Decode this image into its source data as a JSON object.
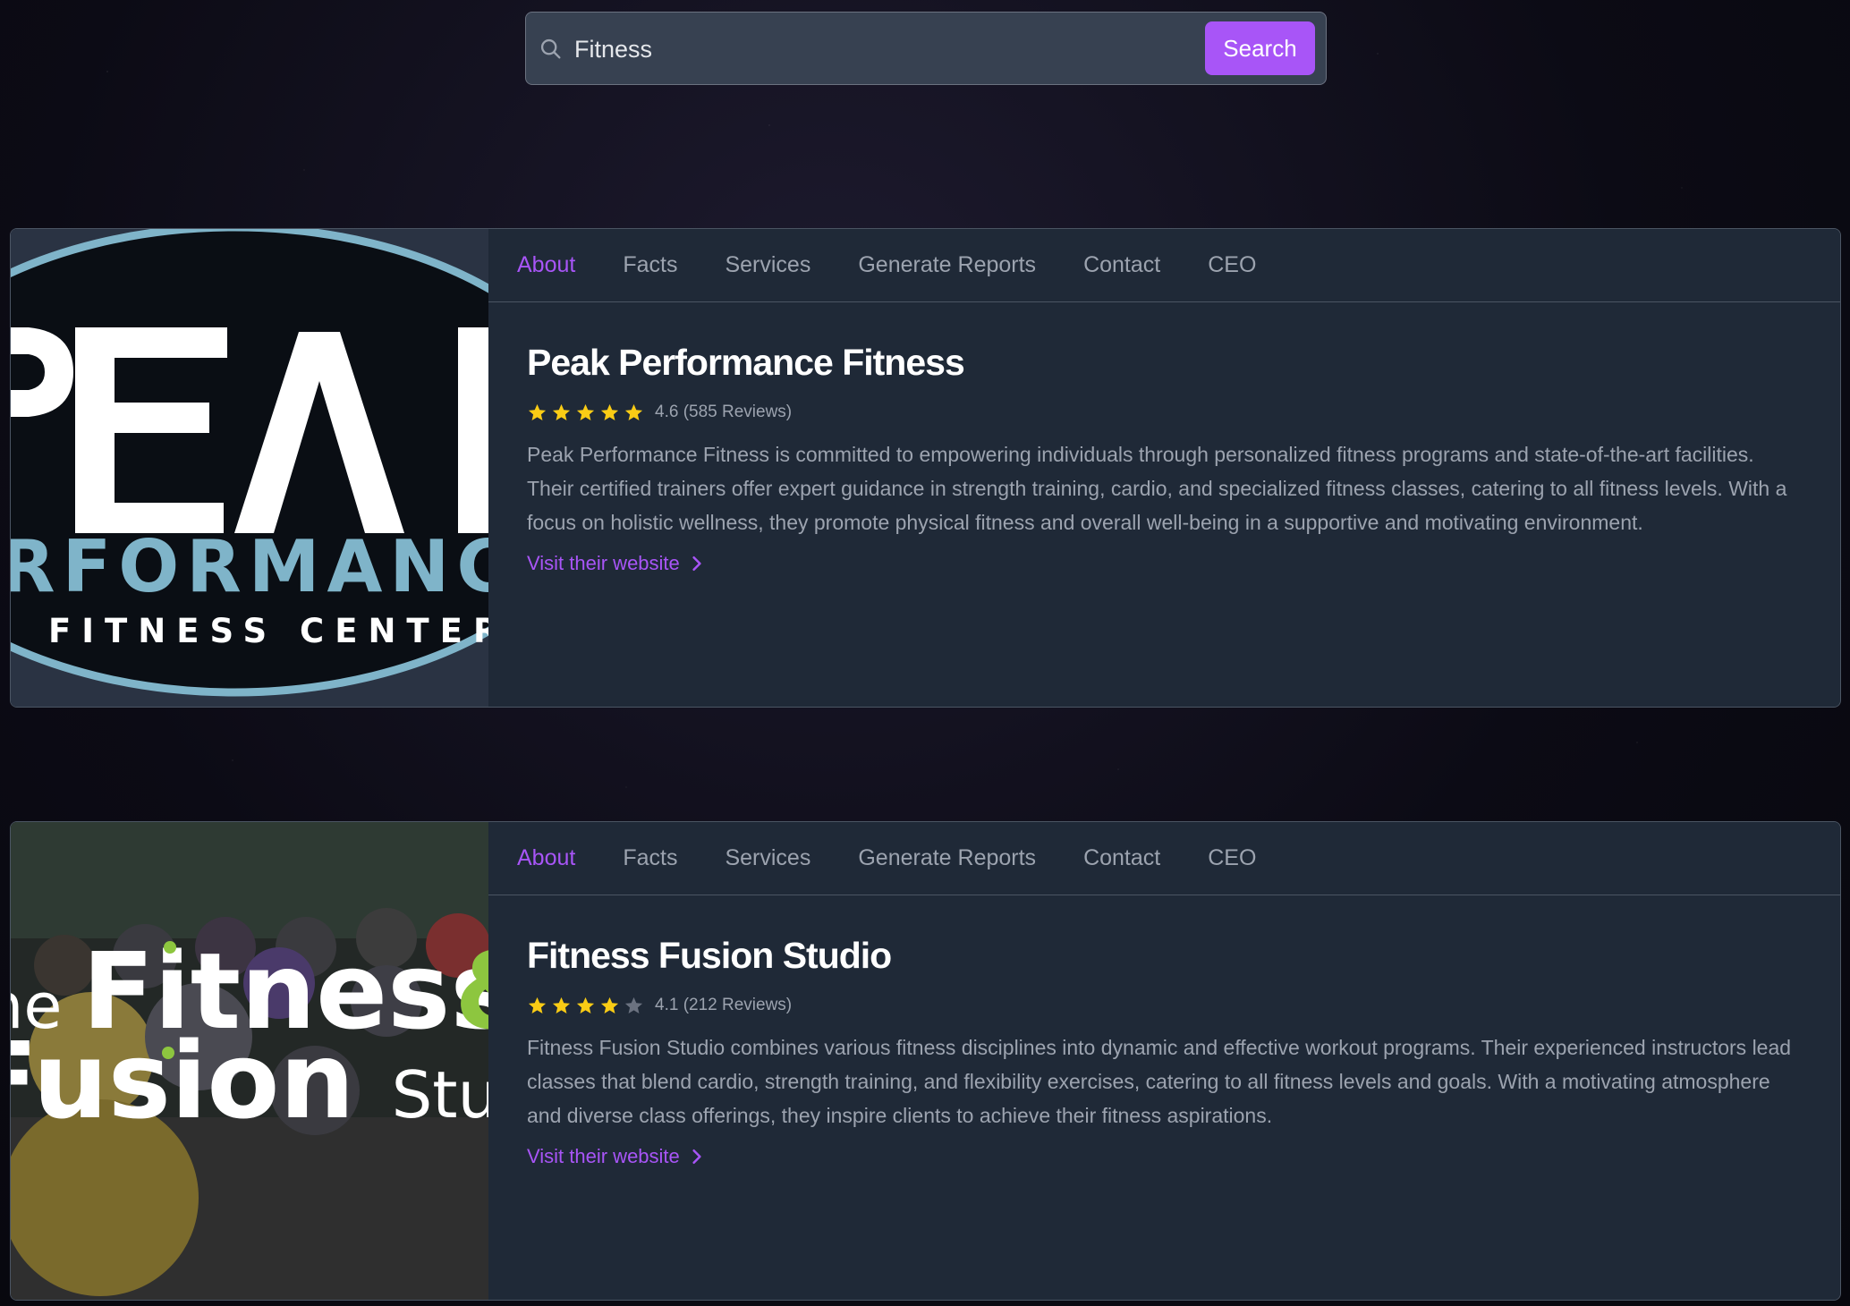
{
  "search": {
    "value": "Fitness",
    "button_label": "Search"
  },
  "cards": [
    {
      "logo_text": [
        "PEAK",
        "PERFORMANCE",
        "FITNESS CENTER"
      ],
      "tabs": [
        "About",
        "Facts",
        "Services",
        "Generate Reports",
        "Contact",
        "CEO"
      ],
      "active_tab": "About",
      "title": "Peak Performance Fitness",
      "rating": 4.6,
      "rating_text": "4.6 (585 Reviews)",
      "description": "Peak Performance Fitness is committed to empowering individuals through personalized fitness programs and state-of-the-art facilities. Their certified trainers offer expert guidance in strength training, cardio, and specialized fitness classes, catering to all fitness levels. With a focus on holistic wellness, they promote physical fitness and overall well-being in a supportive and motivating environment.",
      "link_label": "Visit their website"
    },
    {
      "logo_text": [
        "The Fitness &",
        "Fusion Studio"
      ],
      "tabs": [
        "About",
        "Facts",
        "Services",
        "Generate Reports",
        "Contact",
        "CEO"
      ],
      "active_tab": "About",
      "title": "Fitness Fusion Studio",
      "rating": 4.1,
      "rating_text": "4.1 (212 Reviews)",
      "description": "Fitness Fusion Studio combines various fitness disciplines into dynamic and effective workout programs. Their experienced instructors lead classes that blend cardio, strength training, and flexibility exercises, catering to all fitness levels and goals. With a motivating atmosphere and diverse class offerings, they inspire clients to achieve their fitness aspirations.",
      "link_label": "Visit their website"
    }
  ],
  "colors": {
    "accent": "#a855f7",
    "star_filled": "#facc15",
    "star_empty": "#6b7280",
    "card_bg": "#1f2937",
    "muted_text": "#9ca3af"
  }
}
